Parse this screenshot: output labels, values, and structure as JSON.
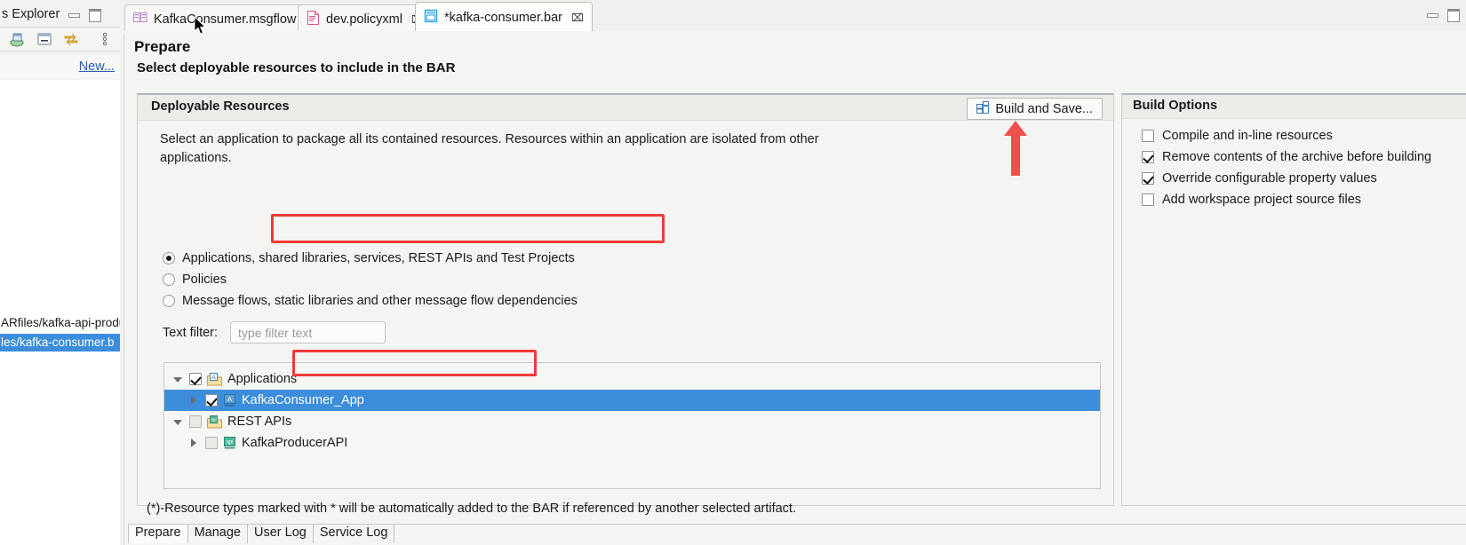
{
  "left_panel": {
    "title": "s Explorer",
    "minimize_icon": "minimize-icon",
    "maximize_icon": "maximize-icon",
    "toolbar_icons": [
      "deploy-icon",
      "collapse-all-icon",
      "link-with-editor-icon",
      "view-menu-icon"
    ],
    "new_link": "New...",
    "files": [
      "ARfiles/kafka-api-produ",
      "les/kafka-consumer.b"
    ]
  },
  "tabs": [
    {
      "label": "KafkaConsumer.msgflow",
      "icon": "msgflow-icon",
      "closable": false,
      "active": false
    },
    {
      "label": "dev.policyxml",
      "icon": "policy-icon",
      "closable": true,
      "close_glyph": "⌧",
      "active": false
    },
    {
      "label": "*kafka-consumer.bar",
      "icon": "bar-file-icon",
      "closable": true,
      "close_glyph": "⌧",
      "active": true
    }
  ],
  "window_controls": {
    "minimize_icon": "minimize-icon",
    "maximize_icon": "maximize-icon"
  },
  "editor": {
    "title": "Prepare",
    "subtitle": "Select deployable resources to include in the BAR"
  },
  "deployable_resources": {
    "group_title": "Deployable Resources",
    "build_and_save_label": "Build and Save...",
    "build_and_save_icon": "bar-build-icon",
    "description": "Select an application to package all its contained resources. Resources within an application are isolated from other applications.",
    "radios": [
      {
        "label": "Applications, shared libraries, services, REST APIs and Test Projects",
        "selected": true
      },
      {
        "label": "Policies",
        "selected": false
      },
      {
        "label": "Message flows, static libraries and other message flow dependencies",
        "selected": false
      }
    ],
    "filter_label": "Text filter:",
    "filter_value": "",
    "filter_placeholder": "type filter text",
    "tree": [
      {
        "label": "Applications",
        "indent": 0,
        "twisty": "open",
        "checked": true,
        "enabled": true,
        "icon": "applications-folder-icon",
        "selected": false
      },
      {
        "label": "KafkaConsumer_App",
        "indent": 1,
        "twisty": "closed",
        "checked": true,
        "enabled": true,
        "icon": "application-icon",
        "selected": true
      },
      {
        "label": "REST APIs",
        "indent": 0,
        "twisty": "open",
        "checked": false,
        "enabled": false,
        "icon": "rest-apis-folder-icon",
        "selected": false
      },
      {
        "label": "KafkaProducerAPI",
        "indent": 1,
        "twisty": "closed",
        "checked": false,
        "enabled": false,
        "icon": "rest-api-icon",
        "selected": false
      }
    ],
    "footnote": "(*)-Resource types marked with * will be automatically added to the BAR if referenced by another selected artifact."
  },
  "build_options": {
    "group_title": "Build Options",
    "options": [
      {
        "label": "Compile and in-line resources",
        "checked": false
      },
      {
        "label": "Remove contents of the archive before building",
        "checked": true
      },
      {
        "label": "Override configurable property values",
        "checked": true
      },
      {
        "label": "Add workspace project source files",
        "checked": false
      }
    ]
  },
  "bottom_tabs": [
    {
      "label": "Prepare",
      "active": true
    },
    {
      "label": "Manage",
      "active": false
    },
    {
      "label": "User Log",
      "active": false
    },
    {
      "label": "Service Log",
      "active": false
    }
  ],
  "annotations": {
    "highlight_color": "#ef3a37",
    "arrow_color": "#f0504d",
    "boxes": [
      "radio-applications-highlight",
      "tree-kafkaconsumer-app-highlight"
    ],
    "arrow": "build-and-save-arrow"
  },
  "colors": {
    "selection_blue": "#3c8ddc",
    "link_blue": "#2a5db0",
    "panel_bg": "#f4f4f2"
  }
}
